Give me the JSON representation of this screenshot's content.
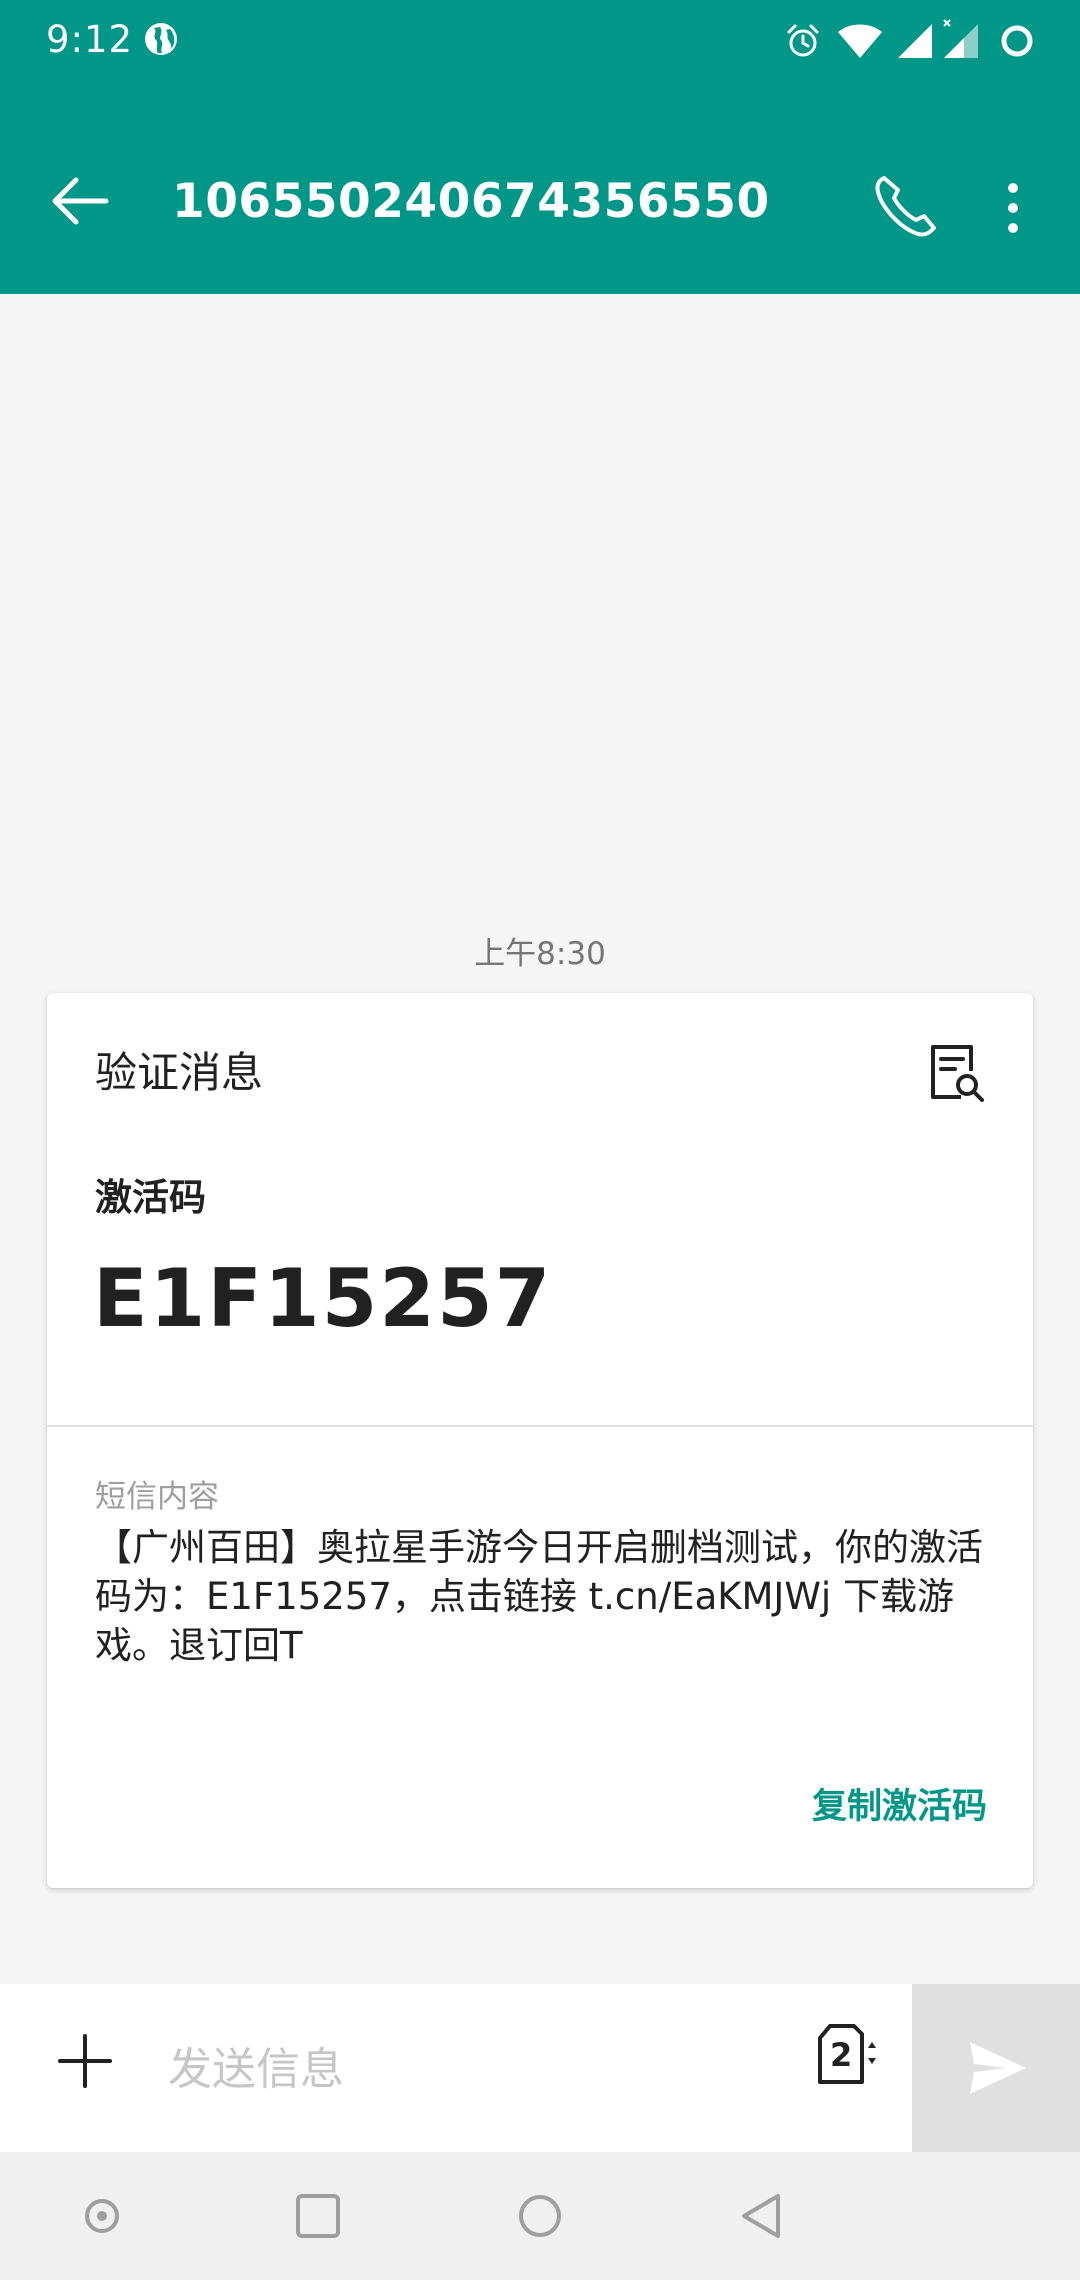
{
  "status_bar": {
    "time": "9:12",
    "icons": [
      "globe-icon",
      "alarm-icon",
      "wifi-icon",
      "signal-icon",
      "signal-icon-no-data",
      "battery-ring-icon"
    ]
  },
  "app_bar": {
    "title": "10655024067435655 0",
    "back_icon": "arrow-left-icon",
    "call_icon": "phone-icon",
    "more_icon": "more-vert-icon"
  },
  "conversation": {
    "timestamp": "上午8:30",
    "card": {
      "title": "验证消息",
      "detail_icon": "document-search-icon",
      "code_label": "激活码",
      "code_value": "E1F15257",
      "sms_label": "短信内容",
      "sms_body": "【广州百田】奥拉星手游今日开启删档测试，你的激活码为：E1F15257，点击链接 t.cn/EaKMJWj 下载游戏。退订回T",
      "copy_button_label": "复制激活码"
    }
  },
  "compose": {
    "placeholder": "发送信息",
    "value": "",
    "sim_slot": "2",
    "attach_icon": "plus-icon",
    "send_icon": "send-icon"
  },
  "nav_bar": {
    "icons": [
      "accessibility-dot-icon",
      "recents-square-icon",
      "home-circle-icon",
      "back-triangle-icon"
    ]
  },
  "colors": {
    "primary": "#009688",
    "accent_text": "#009688",
    "background": "#f5f5f5",
    "card": "#ffffff",
    "send_button_disabled": "#e0e0e0"
  }
}
